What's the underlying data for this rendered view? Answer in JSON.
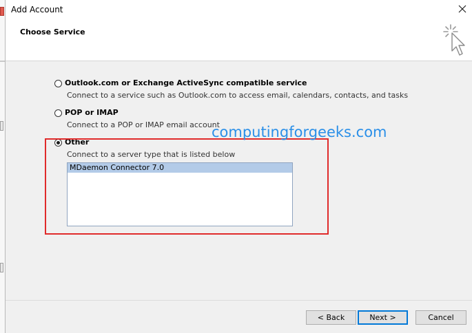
{
  "window": {
    "title": "Add Account",
    "subtitle": "Choose Service"
  },
  "options": [
    {
      "label": "Outlook.com or Exchange ActiveSync compatible service",
      "description": "Connect to a service such as Outlook.com to access email, calendars, contacts, and tasks",
      "selected": false
    },
    {
      "label": "POP or IMAP",
      "description": "Connect to a POP or IMAP email account",
      "selected": false
    },
    {
      "label": "Other",
      "description": "Connect to a server type that is listed below",
      "selected": true
    }
  ],
  "server_types": {
    "items": [
      "MDaemon Connector 7.0"
    ],
    "selected": "MDaemon Connector 7.0"
  },
  "watermark": "computingforgeeks.com",
  "buttons": {
    "back": "< Back",
    "next": "Next >",
    "cancel": "Cancel"
  },
  "colors": {
    "highlight_border": "#e02a2a",
    "watermark": "#2a8fe8",
    "selection": "#b3cbe8",
    "default_button_border": "#0078d7"
  },
  "icons": {
    "close": "close-icon",
    "wizard": "cursor-sparkle-icon"
  }
}
